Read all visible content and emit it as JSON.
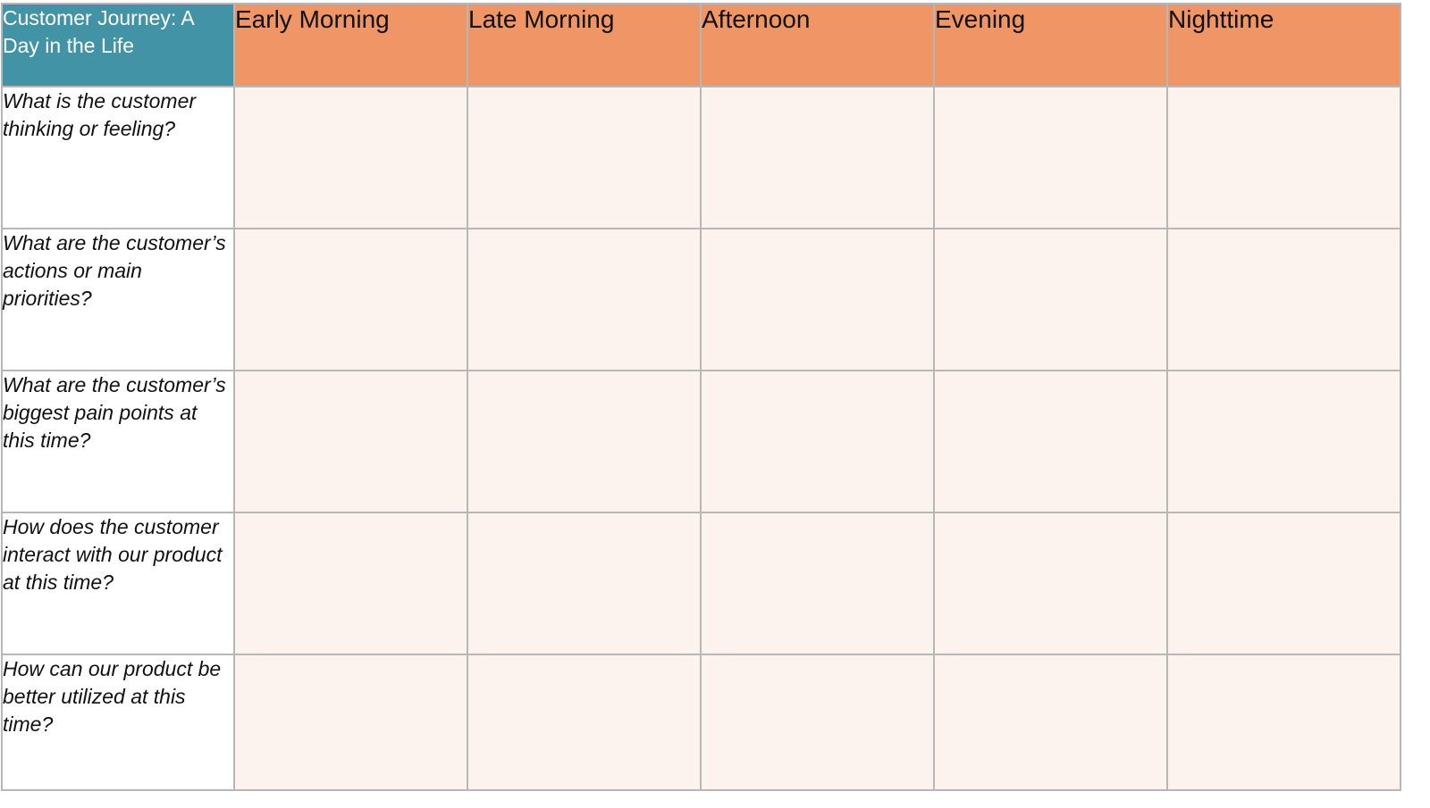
{
  "table": {
    "corner_title": "Customer Journey: A Day in the Life",
    "periods": [
      "Early Morning",
      "Late Morning",
      "Afternoon",
      "Evening",
      "Nighttime"
    ],
    "questions": [
      "What is the customer thinking or feeling?",
      "What are the customer’s actions or main priorities?",
      "What are the customer’s biggest pain points at this time?",
      "How does the customer interact with our product at this time?",
      "How can our product be better utilized at this time?"
    ],
    "cells": [
      [
        "",
        "",
        "",
        "",
        ""
      ],
      [
        "",
        "",
        "",
        "",
        ""
      ],
      [
        "",
        "",
        "",
        "",
        ""
      ],
      [
        "",
        "",
        "",
        "",
        ""
      ],
      [
        "",
        "",
        "",
        "",
        ""
      ]
    ]
  },
  "colors": {
    "corner_bg": "#4393a6",
    "header_bg": "#f09566",
    "cell_bg": "#fcf3ef",
    "border": "#b7b7b7"
  }
}
